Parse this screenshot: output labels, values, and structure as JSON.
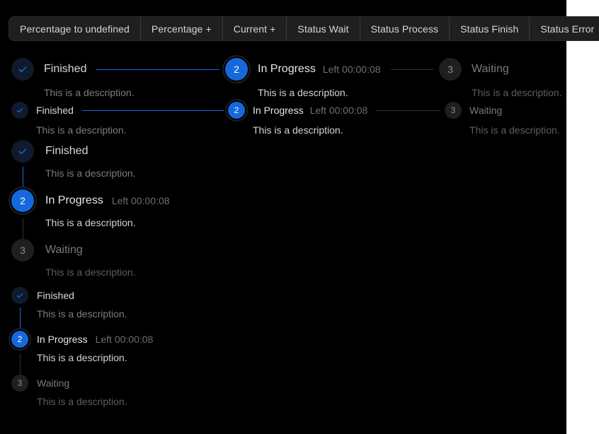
{
  "theme": {
    "background": "#000000",
    "outside_background": "#ffffff",
    "accent": "#1668dc",
    "finish_dot_bg": "#111a2c",
    "wait_dot_bg": "#1f1f1f",
    "button_bg": "#1f1f1f",
    "button_text": "#d6d6d6",
    "divider": "#303030"
  },
  "toolbar": {
    "name": "steps-demo-toolbar",
    "buttons": [
      {
        "label": "Percentage to undefined"
      },
      {
        "label": "Percentage +"
      },
      {
        "label": "Current +"
      },
      {
        "label": "Status Wait"
      },
      {
        "label": "Status Process"
      },
      {
        "label": "Status Finish"
      },
      {
        "label": "Status Error"
      }
    ]
  },
  "labels": {
    "finished": "Finished",
    "in_progress": "In Progress",
    "waiting": "Waiting",
    "left_time": "Left 00:00:08",
    "description": "This is a description.",
    "step_number_2": "2",
    "step_number_3": "3",
    "check_icon": "check-icon"
  },
  "groups": [
    {
      "name": "horizontal-steps-default",
      "orientation": "horizontal",
      "size": "default",
      "steps": [
        {
          "status": "finish",
          "title": "Finished",
          "subtitle": "",
          "description": "This is a description.",
          "icon": "check-icon",
          "number": ""
        },
        {
          "status": "process",
          "title": "In Progress",
          "subtitle": "Left 00:00:08",
          "description": "This is a description.",
          "icon": "",
          "number": "2"
        },
        {
          "status": "wait",
          "title": "Waiting",
          "subtitle": "",
          "description": "This is a description.",
          "icon": "",
          "number": "3"
        }
      ]
    },
    {
      "name": "horizontal-steps-small",
      "orientation": "horizontal",
      "size": "small",
      "steps": [
        {
          "status": "finish",
          "title": "Finished",
          "subtitle": "",
          "description": "This is a description.",
          "icon": "check-icon",
          "number": ""
        },
        {
          "status": "process",
          "title": "In Progress",
          "subtitle": "Left 00:00:08",
          "description": "This is a description.",
          "icon": "",
          "number": "2"
        },
        {
          "status": "wait",
          "title": "Waiting",
          "subtitle": "",
          "description": "This is a description.",
          "icon": "",
          "number": "3"
        }
      ]
    },
    {
      "name": "vertical-steps-default",
      "orientation": "vertical",
      "size": "default",
      "steps": [
        {
          "status": "finish",
          "title": "Finished",
          "subtitle": "",
          "description": "This is a description.",
          "icon": "check-icon",
          "number": ""
        },
        {
          "status": "process",
          "title": "In Progress",
          "subtitle": "Left 00:00:08",
          "description": "This is a description.",
          "icon": "",
          "number": "2"
        },
        {
          "status": "wait",
          "title": "Waiting",
          "subtitle": "",
          "description": "This is a description.",
          "icon": "",
          "number": "3"
        }
      ]
    },
    {
      "name": "vertical-steps-small",
      "orientation": "vertical",
      "size": "small",
      "steps": [
        {
          "status": "finish",
          "title": "Finished",
          "subtitle": "",
          "description": "This is a description.",
          "icon": "check-icon",
          "number": ""
        },
        {
          "status": "process",
          "title": "In Progress",
          "subtitle": "Left 00:00:08",
          "description": "This is a description.",
          "icon": "",
          "number": "2"
        },
        {
          "status": "wait",
          "title": "Waiting",
          "subtitle": "",
          "description": "This is a description.",
          "icon": "",
          "number": "3"
        }
      ]
    }
  ]
}
